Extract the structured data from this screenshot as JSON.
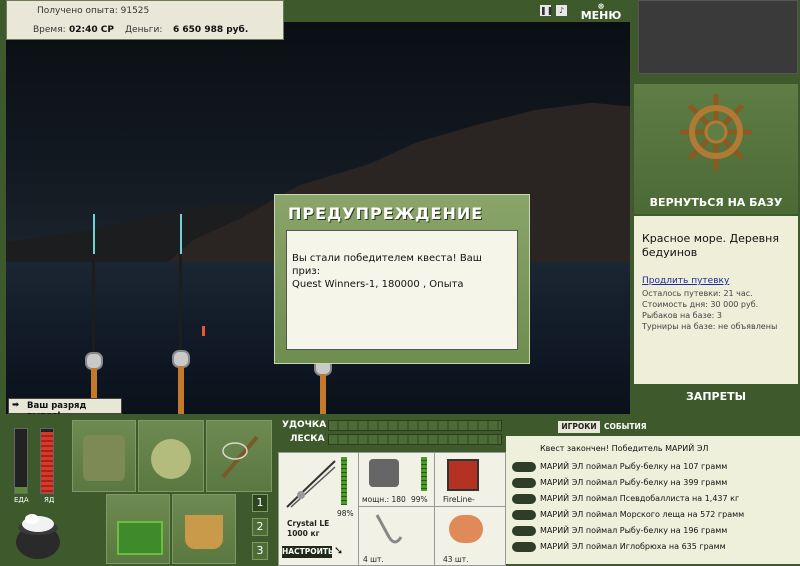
{
  "stats": {
    "exp_label": "Получено опыта:",
    "exp_value": "91525",
    "time_label": "Время:",
    "time_value": "02:40 СР",
    "money_label": "Деньги:",
    "money_value": "6 650 988 руб."
  },
  "topbar": {
    "menu_label": "МЕНЮ",
    "pause_icon": "pause-icon",
    "sound_icon": "sound-icon"
  },
  "dialog": {
    "title": "ПРЕДУПРЕЖДЕНИЕ",
    "text_line1": "Вы стали победителем квеста! Ваш приз:",
    "text_line2": "Quest Winners-1, 180000 , Опыта"
  },
  "toast": {
    "text": "Ваш разряд вырос!"
  },
  "right": {
    "return_label": "ВЕРНУТЬСЯ НА БАЗУ",
    "location": "Красное море. Деревня бедуинов",
    "extend_label": "Продлить путевку",
    "info": [
      "Осталось путевки: 21 час.",
      "Стоимость дня: 30 000 руб.",
      "Рыбаков на базе: 3",
      "Турниры на базе: не объявлены"
    ],
    "bans_label": "ЗАПРЕТЫ"
  },
  "gauges": {
    "food_label": "ЕДА",
    "poison_label": "ЯД",
    "food_level": 0.1,
    "poison_level": 0.95
  },
  "inventory": {
    "pages": [
      "1",
      "2",
      "3"
    ]
  },
  "tackle": {
    "rod_label": "УДОЧКА",
    "line_label": "ЛЕСКА",
    "rod_name": "Crystal LE",
    "rod_capacity": "1000 кг",
    "rod_percent": "98%",
    "reel_text": "мощн.: 180",
    "reel_percent": "99%",
    "line_name": "FireLine-",
    "hook_count": "4 шт.",
    "bait_count": "43 шт.",
    "setup_label": "НАСТРОИТЬ"
  },
  "log": {
    "tab_players": "ИГРОКИ",
    "tab_events": "СОБЫТИЯ",
    "header": "Квест закончен! Победитель МАРИЙ ЭЛ",
    "lines": [
      "МАРИЙ ЭЛ поймал Рыбу-белку на 107 грамм",
      "МАРИЙ ЭЛ поймал Рыбу-белку на 399 грамм",
      "МАРИЙ ЭЛ поймал Псевдобаллиста на 1,437 кг",
      "МАРИЙ ЭЛ поймал Морского леща на 572 грамм",
      "МАРИЙ ЭЛ поймал Рыбу-белку на 196 грамм",
      "МАРИЙ ЭЛ поймал Иглобрюха на 635 грамм"
    ]
  },
  "colors": {
    "panel_green": "#3e5a2c",
    "accent_green": "#6f8d50",
    "cream": "#efeed9"
  }
}
